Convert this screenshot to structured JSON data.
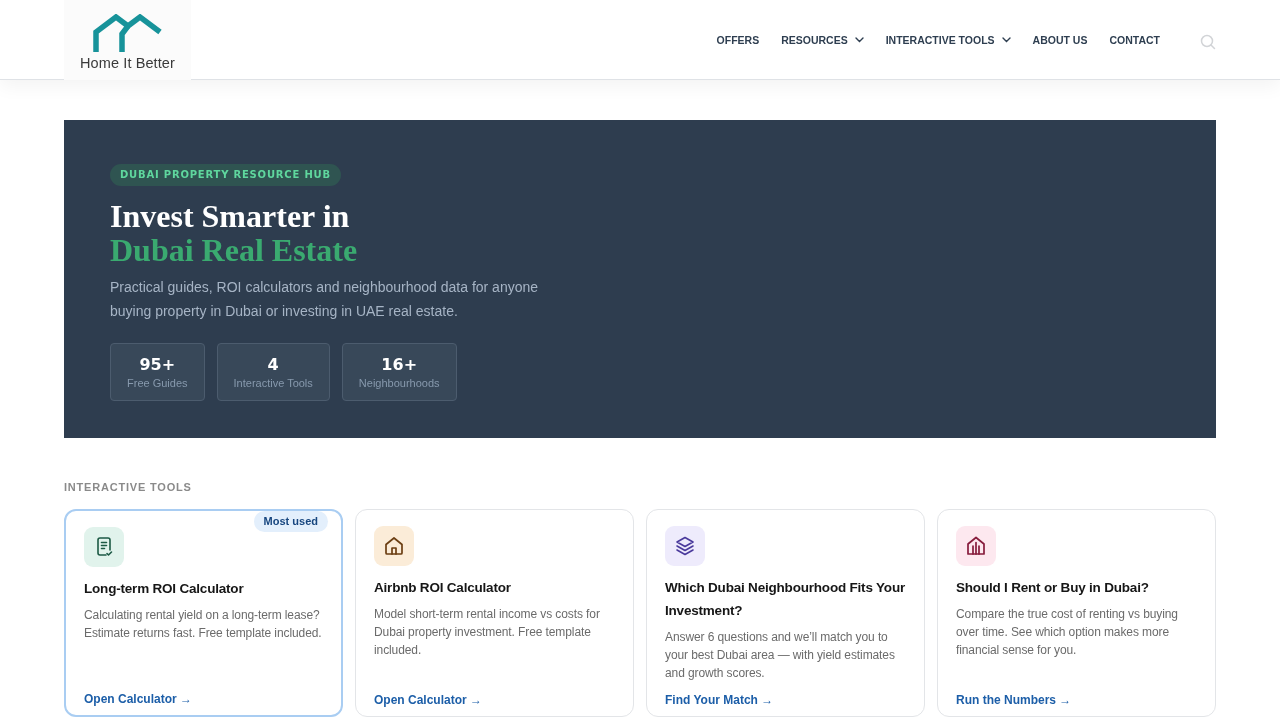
{
  "header": {
    "logo_text": "Home It Better",
    "nav": [
      {
        "label": "OFFERS",
        "dropdown": false
      },
      {
        "label": "RESOURCES",
        "dropdown": true
      },
      {
        "label": "INTERACTIVE TOOLS",
        "dropdown": true
      },
      {
        "label": "ABOUT US",
        "dropdown": false
      },
      {
        "label": "CONTACT",
        "dropdown": false
      }
    ]
  },
  "hero": {
    "tag": "DUBAI PROPERTY RESOURCE HUB",
    "heading": "Invest Smarter in",
    "heading_highlight": "Dubai Real Estate",
    "description": "Practical guides, ROI calculators and neighbourhood data for anyone buying property in Dubai or investing in UAE real estate.",
    "stats": [
      {
        "value": "95+",
        "label": "Free Guides"
      },
      {
        "value": "4",
        "label": "Interactive Tools"
      },
      {
        "value": "16+",
        "label": "Neighbourhoods"
      }
    ]
  },
  "tools_section": {
    "heading": "INTERACTIVE TOOLS",
    "tools": [
      {
        "title": "Long-term ROI Calculator",
        "description": "Calculating rental yield on a long-term lease? Estimate returns fast. Free template included.",
        "link": "Open Calculator →",
        "highlighted": true,
        "badge": "Most used"
      },
      {
        "title": "Airbnb ROI Calculator",
        "description": "Model short-term rental income vs costs for Dubai property investment. Free template included.",
        "link": "Open Calculator →",
        "highlighted": false
      },
      {
        "title": "Which Dubai Neighbourhood Fits Your Investment?",
        "description": "Answer 6 questions and we’ll match you to your best Dubai area — with yield estimates and growth scores.",
        "link": "Find Your Match →",
        "highlighted": false
      },
      {
        "title": "Should I Rent or Buy in Dubai?",
        "description": "Compare the true cost of renting vs buying over time. See which option makes more financial sense for you.",
        "link": "Run the Numbers →",
        "highlighted": false
      }
    ]
  }
}
